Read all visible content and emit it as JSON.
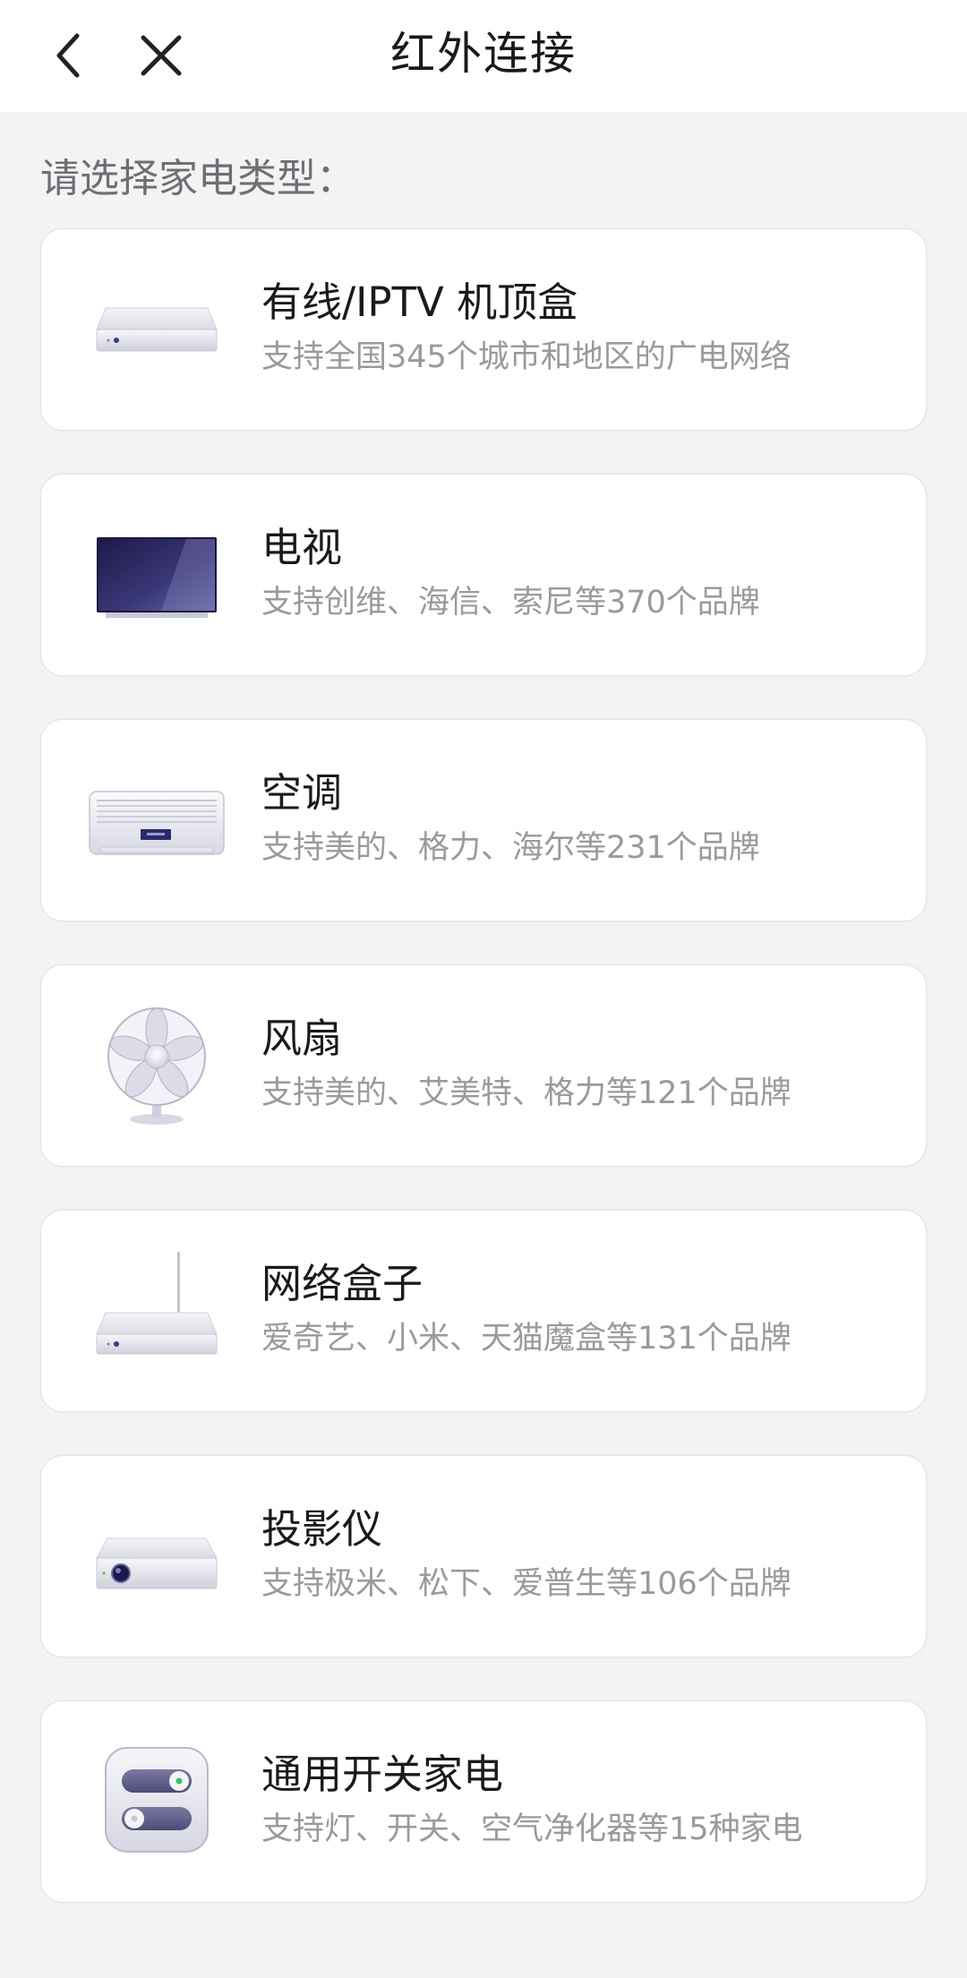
{
  "header": {
    "title": "红外连接",
    "back_icon": "chevron-left-icon",
    "close_icon": "close-icon"
  },
  "prompt": "请选择家电类型：",
  "devices": [
    {
      "title": "有线/IPTV 机顶盒",
      "subtitle": "支持全国345个城市和地区的广电网络",
      "icon": "set-top-box-icon"
    },
    {
      "title": "电视",
      "subtitle": "支持创维、海信、索尼等370个品牌",
      "icon": "tv-icon"
    },
    {
      "title": "空调",
      "subtitle": "支持美的、格力、海尔等231个品牌",
      "icon": "air-conditioner-icon"
    },
    {
      "title": "风扇",
      "subtitle": "支持美的、艾美特、格力等121个品牌",
      "icon": "fan-icon"
    },
    {
      "title": "网络盒子",
      "subtitle": "爱奇艺、小米、天猫魔盒等131个品牌",
      "icon": "network-box-icon"
    },
    {
      "title": "投影仪",
      "subtitle": "支持极米、松下、爱普生等106个品牌",
      "icon": "projector-icon"
    },
    {
      "title": "通用开关家电",
      "subtitle": "支持灯、开关、空气净化器等15种家电",
      "icon": "switch-icon"
    }
  ]
}
